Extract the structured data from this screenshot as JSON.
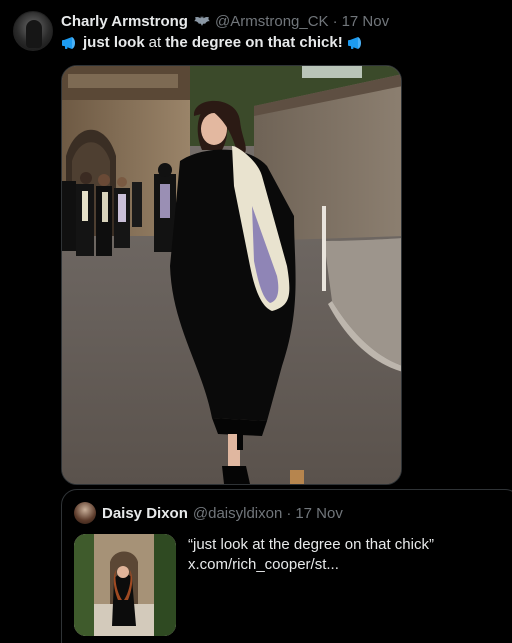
{
  "tweet": {
    "author_name": "Charly Armstrong",
    "handle": "@Armstrong_CK",
    "separator": "·",
    "date": "17 Nov",
    "text_part1": "just look",
    "text_part2": "at",
    "text_part3": "the degree on that chick!",
    "icons": {
      "badge": "bat-icon",
      "emoji": "megaphone-icon"
    }
  },
  "quoted": {
    "author_name": "Daisy Dixon",
    "handle": "@daisyldixon",
    "separator": "·",
    "date": "17 Nov",
    "text_line1": "“just look at the degree on that chick”",
    "text_line2": "x.com/rich_cooper/st..."
  },
  "colors": {
    "background": "#000000",
    "text": "#e7e9ea",
    "muted": "#71767b",
    "border": "#2f3336",
    "accent": "#1d9bf0"
  }
}
